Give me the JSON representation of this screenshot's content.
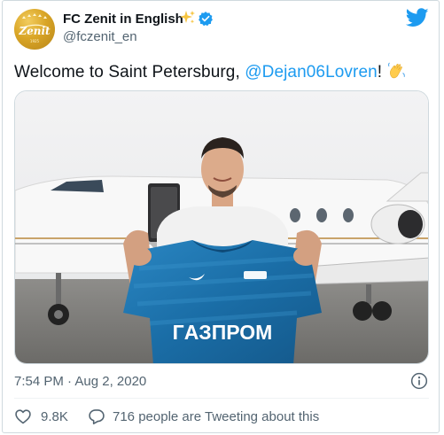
{
  "account": {
    "display_name": "FC Zenit in English",
    "handle": "@fczenit_en",
    "avatar_text": "Zenit",
    "avatar_year": "1925"
  },
  "tweet": {
    "text_before": "Welcome to Saint Petersburg, ",
    "mention": "@Dejan06Lovren",
    "text_after": "!",
    "emoji": "waving-hands-icon"
  },
  "media": {
    "shirt_sponsor": "ГАЗПРОМ",
    "shirt_sponsor_display": "ГΑЗПРОМ"
  },
  "footer": {
    "timestamp": "7:54 PM · Aug 2, 2020",
    "likes": "9.8K",
    "tweeting_text": "716 people are Tweeting about this"
  },
  "colors": {
    "link": "#1d9bf0",
    "twitter_blue": "#1d9bf0",
    "secondary_text": "#536471",
    "zenit_blue": "#1b6fa8",
    "avatar_gold": "#d9a526"
  },
  "icons": {
    "verified": "verified-badge-icon",
    "sparkles": "sparkles-icon",
    "twitter": "twitter-bird-icon",
    "info": "info-icon",
    "like": "heart-icon",
    "reply": "speech-bubble-icon"
  }
}
